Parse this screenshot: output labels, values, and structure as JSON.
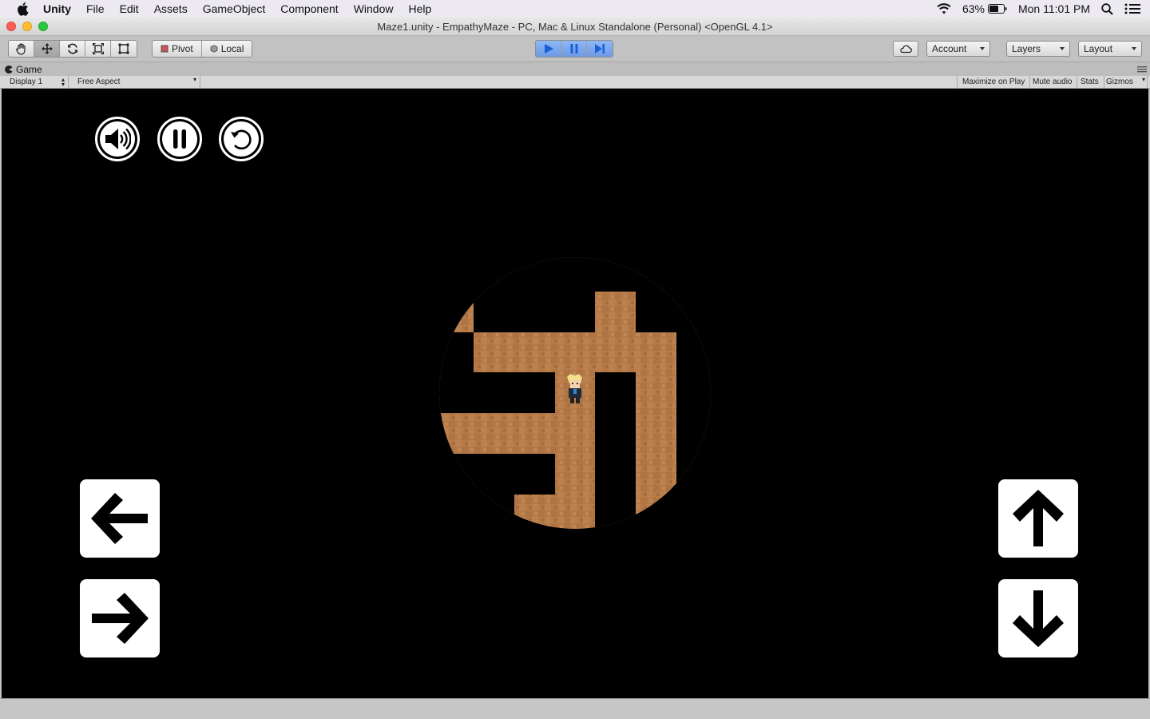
{
  "menubar": {
    "app": "Unity",
    "items": [
      "File",
      "Edit",
      "Assets",
      "GameObject",
      "Component",
      "Window",
      "Help"
    ],
    "battery": "63%",
    "clock": "Mon 11:01 PM"
  },
  "window": {
    "title": "Maze1.unity - EmpathyMaze - PC, Mac & Linux Standalone (Personal) <OpenGL 4.1>"
  },
  "toolbar": {
    "pivot_label": "Pivot",
    "local_label": "Local",
    "account_label": "Account",
    "layers_label": "Layers",
    "layout_label": "Layout"
  },
  "game_panel": {
    "tab_label": "Game",
    "display_select": "Display 1",
    "aspect_select": "Free Aspect",
    "maximize_label": "Maximize on Play",
    "mute_label": "Mute audio",
    "stats_label": "Stats",
    "gizmos_label": "Gizmos"
  },
  "colors": {
    "maze_floor": "#b57a45",
    "play_active": "#4a86e8"
  }
}
